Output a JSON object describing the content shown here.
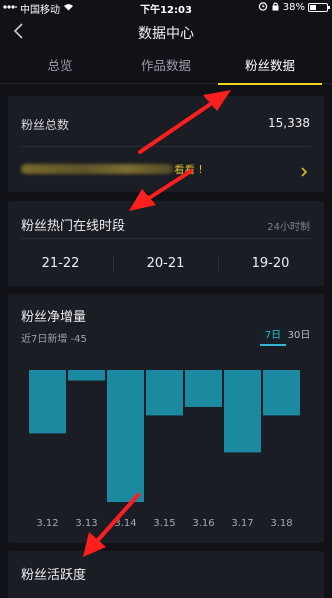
{
  "status_bar": {
    "carrier": "中国移动",
    "time": "下午12:03",
    "battery": "38%",
    "battery_level": 0.38
  },
  "nav": {
    "title": "数据中心"
  },
  "tabs": [
    {
      "label": "总览",
      "active": false
    },
    {
      "label": "作品数据",
      "active": false
    },
    {
      "label": "粉丝数据",
      "active": true
    }
  ],
  "fans_total": {
    "label": "粉丝总数",
    "value": "15,338"
  },
  "promo": {
    "cta": "看看 !"
  },
  "active_hours": {
    "title": "粉丝热门在线时段",
    "unit": "24小时制",
    "slots": [
      "21-22",
      "20-21",
      "19-20"
    ]
  },
  "net_growth": {
    "title": "粉丝净增量",
    "subtitle": "近7日新增 -45",
    "ranges": [
      {
        "label": "7日",
        "active": true
      },
      {
        "label": "30日",
        "active": false
      }
    ]
  },
  "activity": {
    "title": "粉丝活跃度"
  },
  "colors": {
    "accent_yellow": "#f3d024",
    "bar": "#1b8aa1",
    "toggle_active": "#36b6d3",
    "arrow": "#ff1f1f"
  },
  "chart_data": {
    "type": "bar",
    "categories": [
      "3.12",
      "3.13",
      "3.14",
      "3.15",
      "3.16",
      "3.17",
      "3.18"
    ],
    "values": [
      -6,
      -1,
      -12.5,
      -4.3,
      -3.5,
      -7.8,
      -4.3
    ],
    "ylim": [
      -12.5,
      0
    ]
  }
}
